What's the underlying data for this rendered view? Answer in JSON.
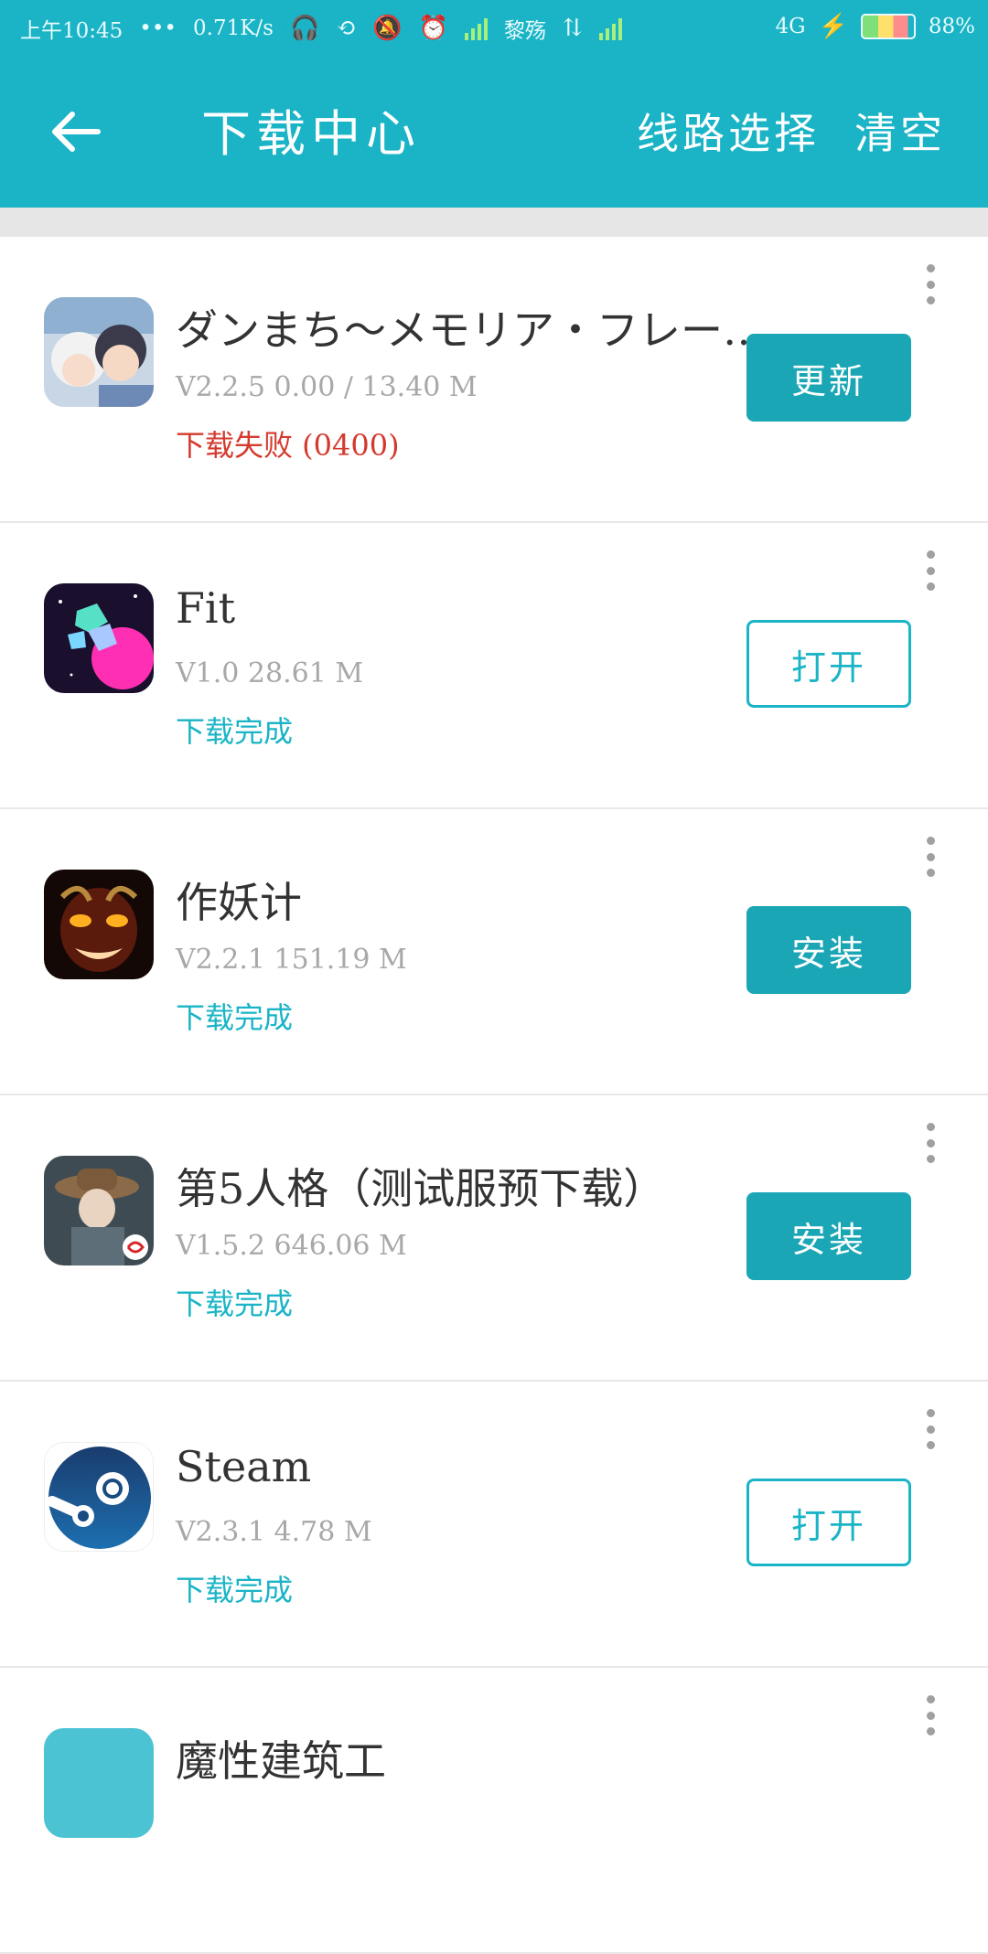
{
  "status_bar": {
    "time": "上午10:45",
    "dots": "•••",
    "speed": "0.71K/s",
    "carrier": "黎殇",
    "network": "4G",
    "battery": "88%"
  },
  "toolbar": {
    "title": "下载中心",
    "route_label": "线路选择",
    "clear_label": "清空"
  },
  "downloads": [
    {
      "name": "ダンまち～メモリア・フレー…",
      "meta": "V2.2.5  0.00 / 13.40 M",
      "status": "下载失败 (0400)",
      "status_type": "fail",
      "action": "更新",
      "action_style": "filled"
    },
    {
      "name": "Fit",
      "meta": "V1.0  28.61 M",
      "status": "下载完成",
      "status_type": "ok",
      "action": "打开",
      "action_style": "outline"
    },
    {
      "name": "作妖计",
      "meta": "V2.2.1  151.19 M",
      "status": "下载完成",
      "status_type": "ok",
      "action": "安装",
      "action_style": "filled"
    },
    {
      "name": "第5人格（测试服预下载）",
      "meta": "V1.5.2  646.06 M",
      "status": "下载完成",
      "status_type": "ok",
      "action": "安装",
      "action_style": "filled"
    },
    {
      "name": "Steam",
      "meta": "V2.3.1  4.78 M",
      "status": "下载完成",
      "status_type": "ok",
      "action": "打开",
      "action_style": "outline"
    },
    {
      "name": "魔性建筑工",
      "meta": "",
      "status": "",
      "status_type": "ok",
      "action": "",
      "action_style": "filled"
    }
  ],
  "colors": {
    "accent": "#1ab4c6",
    "button": "#1ba6b6",
    "fail": "#d43a2e",
    "meta": "#a8a8a8"
  }
}
